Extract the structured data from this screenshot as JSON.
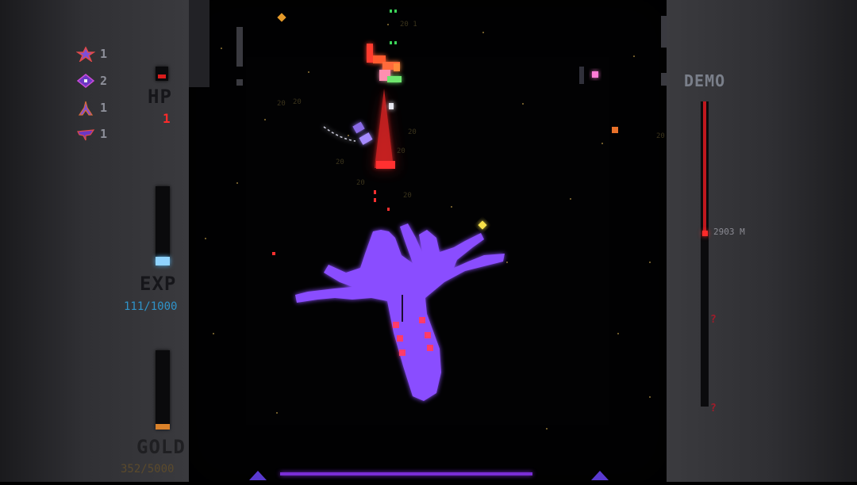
{
  "inventory": [
    {
      "icon": "flower-ship-icon",
      "count": "1"
    },
    {
      "icon": "eye-ship-icon",
      "count": "2"
    },
    {
      "icon": "tripod-ship-icon",
      "count": "1"
    },
    {
      "icon": "saucer-ship-icon",
      "count": "1"
    }
  ],
  "hp": {
    "label": "HP",
    "value": "1",
    "color": "#ff2a2a"
  },
  "exp": {
    "label": "EXP",
    "value": "111/1000",
    "current": 111,
    "max": 1000,
    "color": "#2f93c9"
  },
  "gold": {
    "label": "GOLD",
    "value": "352/5000",
    "current": 352,
    "max": 5000,
    "color": "#e08a2a"
  },
  "mode": {
    "label": "DEMO"
  },
  "progress": {
    "distance": "2903 M",
    "fraction": 0.43,
    "unknown_markers": [
      "?",
      "?"
    ]
  },
  "score_popups": [
    "20 1",
    "20",
    "20",
    "20",
    "20",
    "20",
    "20",
    "20",
    "20"
  ],
  "colors": {
    "boss": "#8a4dff",
    "enemy": "#ff3b2e",
    "accent": "#7a2ed6"
  }
}
